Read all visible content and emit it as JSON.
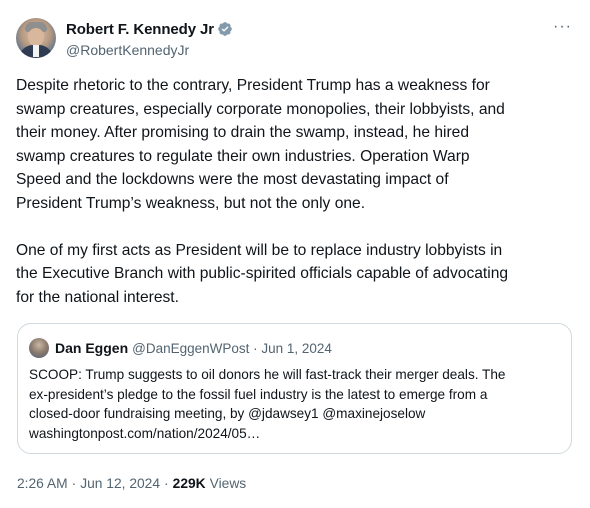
{
  "author": {
    "display_name": "Robert F. Kennedy Jr",
    "handle": "@RobertKennedyJr"
  },
  "post": {
    "text": "Despite rhetoric to the contrary, President Trump has a weakness for\nswamp creatures, especially corporate monopolies, their lobbyists, and\ntheir money. After promising to drain the swamp, instead, he hired\nswamp creatures to regulate their own industries. Operation Warp\nSpeed and the lockdowns were the most devastating impact of\nPresident Trump’s weakness, but not the only one.\n\nOne of my first acts as President will be to replace industry lobbyists in\nthe Executive Branch with public-spirited officials capable of advocating\nfor the national interest."
  },
  "quoted_post": {
    "display_name": "Dan Eggen",
    "handle_date": "@DanEggenWPost · Jun 1, 2024",
    "text": "SCOOP: Trump suggests to oil donors he will fast-track their merger deals. The\nex-president’s pledge to the fossil fuel industry is the latest to emerge from a\nclosed-door fundraising meeting, by @jdawsey1 @maxinejoselow\nwashingtonpost.com/nation/2024/05…"
  },
  "meta": {
    "time": "2:26 AM",
    "date": "Jun 12, 2024",
    "views_count": "229K",
    "views_label": "Views"
  },
  "icons": {
    "verified": "verified-badge-icon",
    "more": "more-options-icon"
  },
  "colors": {
    "text": "#0f1419",
    "secondary": "#536471",
    "verified_gray": "#829aab",
    "border": "#cfd9de"
  }
}
